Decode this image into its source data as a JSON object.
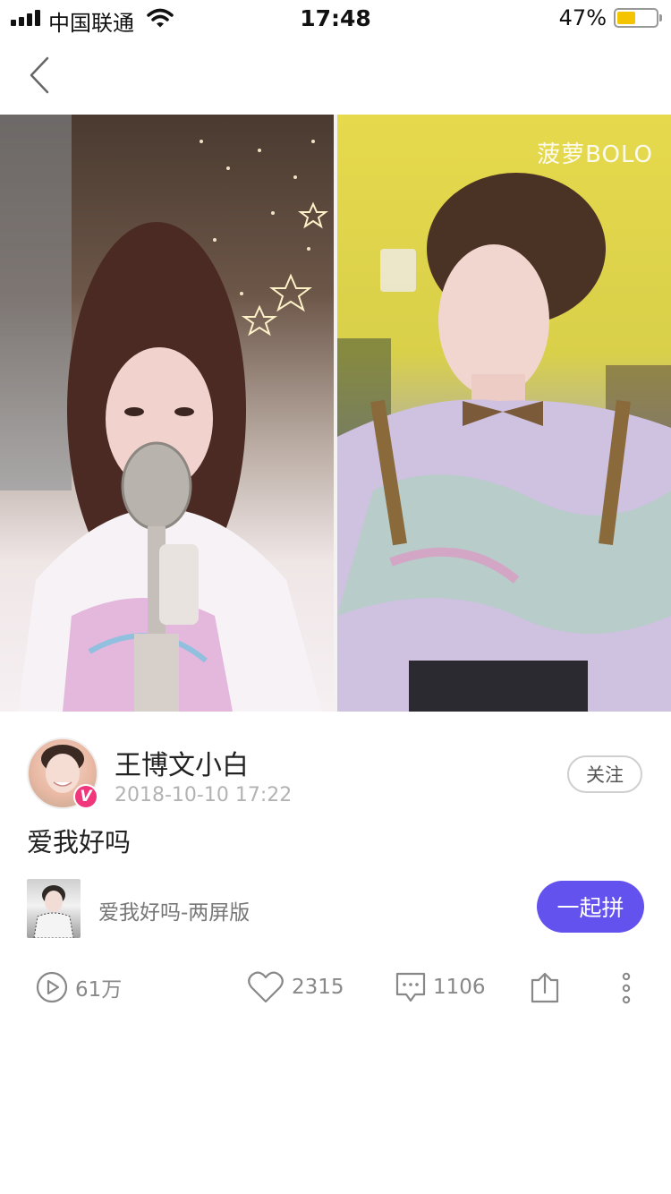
{
  "status_bar": {
    "carrier": "中国联通",
    "time": "17:48",
    "battery_percent": "47%",
    "battery_level": 0.47,
    "battery_color": "#f5c400",
    "signal_icon": "signal-icon",
    "wifi_icon": "wifi-icon"
  },
  "nav": {
    "back_icon": "chevron-left-icon"
  },
  "video": {
    "watermark": "菠萝BOLO"
  },
  "author": {
    "name": "王博文小白",
    "time": "2018-10-10 17:22",
    "verified_badge": "V",
    "follow_label": "关注"
  },
  "post": {
    "caption": "爱我好吗"
  },
  "song": {
    "title": "爱我好吗-两屏版",
    "join_label": "一起拼",
    "accent_color": "#6452ee"
  },
  "actions": {
    "plays": "61万",
    "likes": "2315",
    "comments": "1106"
  }
}
